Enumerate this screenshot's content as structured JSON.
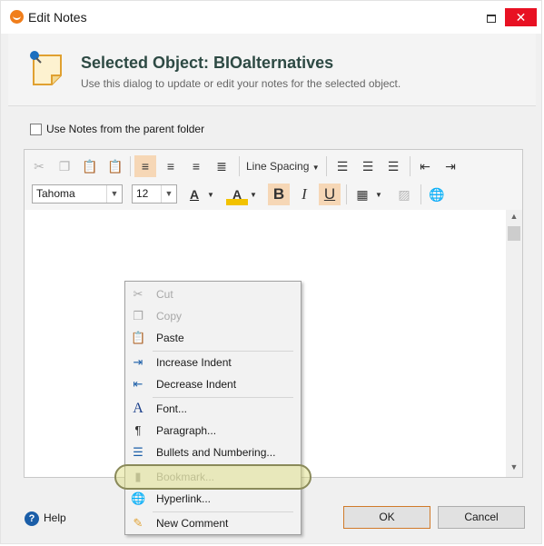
{
  "window": {
    "title": "Edit Notes",
    "close_glyph": "✕"
  },
  "header": {
    "title": "Selected Object: BIOalternatives",
    "subtitle": "Use this dialog to update or edit your notes for the selected object."
  },
  "parent_folder": {
    "label": "Use Notes from the parent folder",
    "checked": false
  },
  "toolbar": {
    "line_spacing_label": "Line Spacing",
    "font_name": "Tahoma",
    "font_size": "12",
    "bold_glyph": "B",
    "italic_glyph": "I",
    "underline_glyph": "U",
    "font_color_glyph": "A",
    "highlight_glyph": "A"
  },
  "context_menu": {
    "items": [
      {
        "label": "Cut",
        "icon": "scissors-icon",
        "enabled": false
      },
      {
        "label": "Copy",
        "icon": "copy-icon",
        "enabled": false
      },
      {
        "label": "Paste",
        "icon": "paste-icon",
        "enabled": true
      },
      {
        "label": "Increase Indent",
        "icon": "increase-indent-icon",
        "enabled": true
      },
      {
        "label": "Decrease Indent",
        "icon": "decrease-indent-icon",
        "enabled": true
      },
      {
        "label": "Font...",
        "icon": "font-icon",
        "enabled": true
      },
      {
        "label": "Paragraph...",
        "icon": "paragraph-icon",
        "enabled": true
      },
      {
        "label": "Bullets and Numbering...",
        "icon": "bullets-icon",
        "enabled": true
      },
      {
        "label": "Bookmark...",
        "icon": "bookmark-icon",
        "enabled": false
      },
      {
        "label": "Hyperlink...",
        "icon": "hyperlink-icon",
        "enabled": true
      },
      {
        "label": "New Comment",
        "icon": "comment-icon",
        "enabled": true
      }
    ]
  },
  "footer": {
    "help_label": "Help",
    "ok_label": "OK",
    "cancel_label": "Cancel"
  },
  "colors": {
    "accent": "#f6d7b6",
    "title": "#2e4a44",
    "close": "#e81123",
    "highlight": "#dcdc78"
  }
}
